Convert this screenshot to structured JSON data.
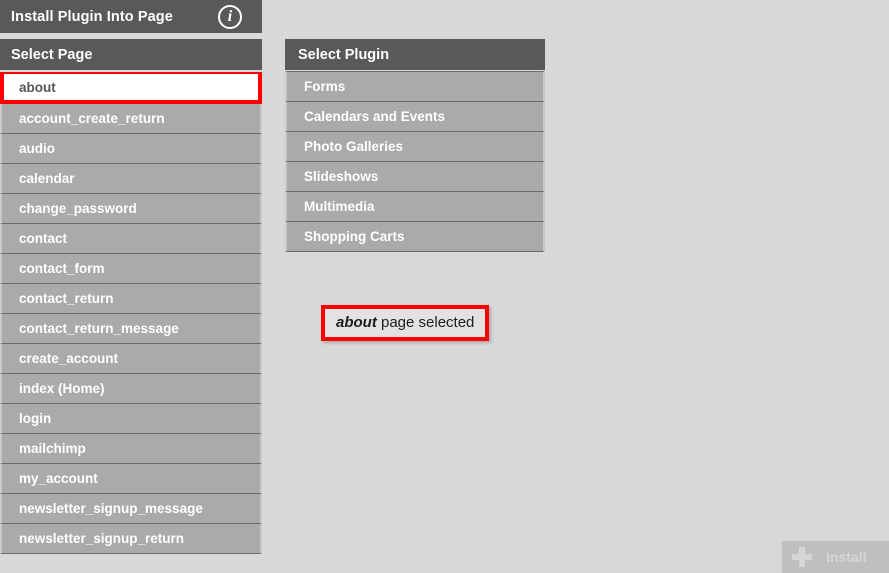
{
  "window": {
    "title": "Install Plugin Into Page",
    "info_icon": "info-circle-icon"
  },
  "sidebar": {
    "header": "Select Page",
    "selected_page": "about",
    "items": [
      {
        "label": "about",
        "selected": true
      },
      {
        "label": "account_create_return",
        "selected": false
      },
      {
        "label": "audio",
        "selected": false
      },
      {
        "label": "calendar",
        "selected": false
      },
      {
        "label": "change_password",
        "selected": false
      },
      {
        "label": "contact",
        "selected": false
      },
      {
        "label": "contact_form",
        "selected": false
      },
      {
        "label": "contact_return",
        "selected": false
      },
      {
        "label": "contact_return_message",
        "selected": false
      },
      {
        "label": "create_account",
        "selected": false
      },
      {
        "label": "index (Home)",
        "selected": false
      },
      {
        "label": "login",
        "selected": false
      },
      {
        "label": "mailchimp",
        "selected": false
      },
      {
        "label": "my_account",
        "selected": false
      },
      {
        "label": "newsletter_signup_message",
        "selected": false
      },
      {
        "label": "newsletter_signup_return",
        "selected": false
      }
    ]
  },
  "plugin_panel": {
    "header": "Select Plugin",
    "items": [
      {
        "label": "Forms"
      },
      {
        "label": "Calendars and Events"
      },
      {
        "label": "Photo Galleries"
      },
      {
        "label": "Slideshows"
      },
      {
        "label": "Multimedia"
      },
      {
        "label": "Shopping Carts"
      }
    ]
  },
  "status": {
    "page_name": "about",
    "suffix": " page selected"
  },
  "footer": {
    "install_label": "Install",
    "plus_icon": "plus-icon",
    "install_enabled": false
  },
  "colors": {
    "header_bar": "#595959",
    "list_item": "#aaaaaa",
    "background": "#d8d8d8",
    "highlight_border": "#ff0000",
    "selected_row_bg": "#ffffff",
    "disabled_button": "#bfbfbf"
  }
}
